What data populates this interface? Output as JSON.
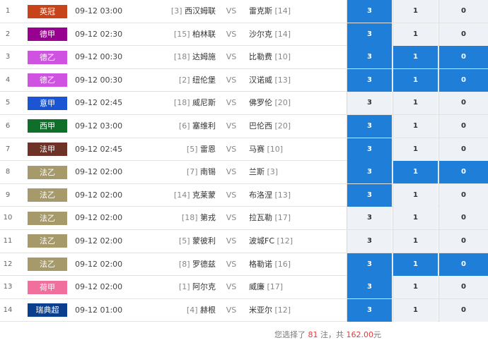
{
  "rows": [
    {
      "num": "1",
      "league": "英冠",
      "color": "#c7431a",
      "time": "09-12 03:00",
      "home_rank": "[3]",
      "home": "西汉姆联",
      "vs": "VS",
      "away": "雷克斯",
      "away_rank": "[14]",
      "odds": [
        "3",
        "1",
        "0"
      ],
      "selected": [
        true,
        false,
        false
      ]
    },
    {
      "num": "2",
      "league": "德甲",
      "color": "#980090",
      "time": "09-12 02:30",
      "home_rank": "[15]",
      "home": "柏林联",
      "vs": "VS",
      "away": "沙尔克",
      "away_rank": "[14]",
      "odds": [
        "3",
        "1",
        "0"
      ],
      "selected": [
        true,
        false,
        false
      ]
    },
    {
      "num": "3",
      "league": "德乙",
      "color": "#d052e0",
      "time": "09-12 00:30",
      "home_rank": "[18]",
      "home": "达姆施",
      "vs": "VS",
      "away": "比勒费",
      "away_rank": "[10]",
      "odds": [
        "3",
        "1",
        "0"
      ],
      "selected": [
        true,
        true,
        true
      ]
    },
    {
      "num": "4",
      "league": "德乙",
      "color": "#d052e0",
      "time": "09-12 00:30",
      "home_rank": "[2]",
      "home": "纽伦堡",
      "vs": "VS",
      "away": "汉诺威",
      "away_rank": "[13]",
      "odds": [
        "3",
        "1",
        "0"
      ],
      "selected": [
        true,
        true,
        true
      ]
    },
    {
      "num": "5",
      "league": "意甲",
      "color": "#1b55d4",
      "time": "09-12 02:45",
      "home_rank": "[18]",
      "home": "威尼斯",
      "vs": "VS",
      "away": "佛罗伦",
      "away_rank": "[20]",
      "odds": [
        "3",
        "1",
        "0"
      ],
      "selected": [
        false,
        false,
        false
      ]
    },
    {
      "num": "6",
      "league": "西甲",
      "color": "#0e6e2a",
      "time": "09-12 03:00",
      "home_rank": "[6]",
      "home": "塞维利",
      "vs": "VS",
      "away": "巴伦西",
      "away_rank": "[20]",
      "odds": [
        "3",
        "1",
        "0"
      ],
      "selected": [
        true,
        false,
        false
      ]
    },
    {
      "num": "7",
      "league": "法甲",
      "color": "#6e3227",
      "time": "09-12 02:45",
      "home_rank": "[5]",
      "home": "雷恩",
      "vs": "VS",
      "away": "马赛",
      "away_rank": "[10]",
      "odds": [
        "3",
        "1",
        "0"
      ],
      "selected": [
        true,
        false,
        false
      ]
    },
    {
      "num": "8",
      "league": "法乙",
      "color": "#a69a6b",
      "time": "09-12 02:00",
      "home_rank": "[7]",
      "home": "南锡",
      "vs": "VS",
      "away": "兰斯",
      "away_rank": "[3]",
      "odds": [
        "3",
        "1",
        "0"
      ],
      "selected": [
        true,
        true,
        true
      ]
    },
    {
      "num": "9",
      "league": "法乙",
      "color": "#a69a6b",
      "time": "09-12 02:00",
      "home_rank": "[14]",
      "home": "克莱蒙",
      "vs": "VS",
      "away": "布洛涅",
      "away_rank": "[13]",
      "odds": [
        "3",
        "1",
        "0"
      ],
      "selected": [
        true,
        false,
        false
      ]
    },
    {
      "num": "10",
      "league": "法乙",
      "color": "#a69a6b",
      "time": "09-12 02:00",
      "home_rank": "[18]",
      "home": "第戎",
      "vs": "VS",
      "away": "拉瓦勒",
      "away_rank": "[17]",
      "odds": [
        "3",
        "1",
        "0"
      ],
      "selected": [
        false,
        false,
        false
      ]
    },
    {
      "num": "11",
      "league": "法乙",
      "color": "#a69a6b",
      "time": "09-12 02:00",
      "home_rank": "[5]",
      "home": "蒙彼利",
      "vs": "VS",
      "away": "波城FC",
      "away_rank": "[12]",
      "odds": [
        "3",
        "1",
        "0"
      ],
      "selected": [
        false,
        false,
        false
      ]
    },
    {
      "num": "12",
      "league": "法乙",
      "color": "#a69a6b",
      "time": "09-12 02:00",
      "home_rank": "[8]",
      "home": "罗德兹",
      "vs": "VS",
      "away": "格勒诺",
      "away_rank": "[16]",
      "odds": [
        "3",
        "1",
        "0"
      ],
      "selected": [
        true,
        true,
        true
      ]
    },
    {
      "num": "13",
      "league": "荷甲",
      "color": "#f06f9c",
      "time": "09-12 02:00",
      "home_rank": "[1]",
      "home": "阿尔克",
      "vs": "VS",
      "away": "威廉",
      "away_rank": "[17]",
      "odds": [
        "3",
        "1",
        "0"
      ],
      "selected": [
        true,
        false,
        false
      ]
    },
    {
      "num": "14",
      "league": "瑞典超",
      "color": "#0b3e8c",
      "time": "09-12 01:00",
      "home_rank": "[4]",
      "home": "赫根",
      "vs": "VS",
      "away": "米亚尔",
      "away_rank": "[12]",
      "odds": [
        "3",
        "1",
        "0"
      ],
      "selected": [
        true,
        false,
        false
      ]
    }
  ],
  "summary": {
    "prefix": "您选择了 ",
    "count": "81",
    "mid": " 注，共 ",
    "amount": "162.00",
    "suffix": "元"
  },
  "colors": {
    "selected": "#1f7ed8",
    "unselected": "#eef2f7",
    "highlight": "#e4393c"
  }
}
